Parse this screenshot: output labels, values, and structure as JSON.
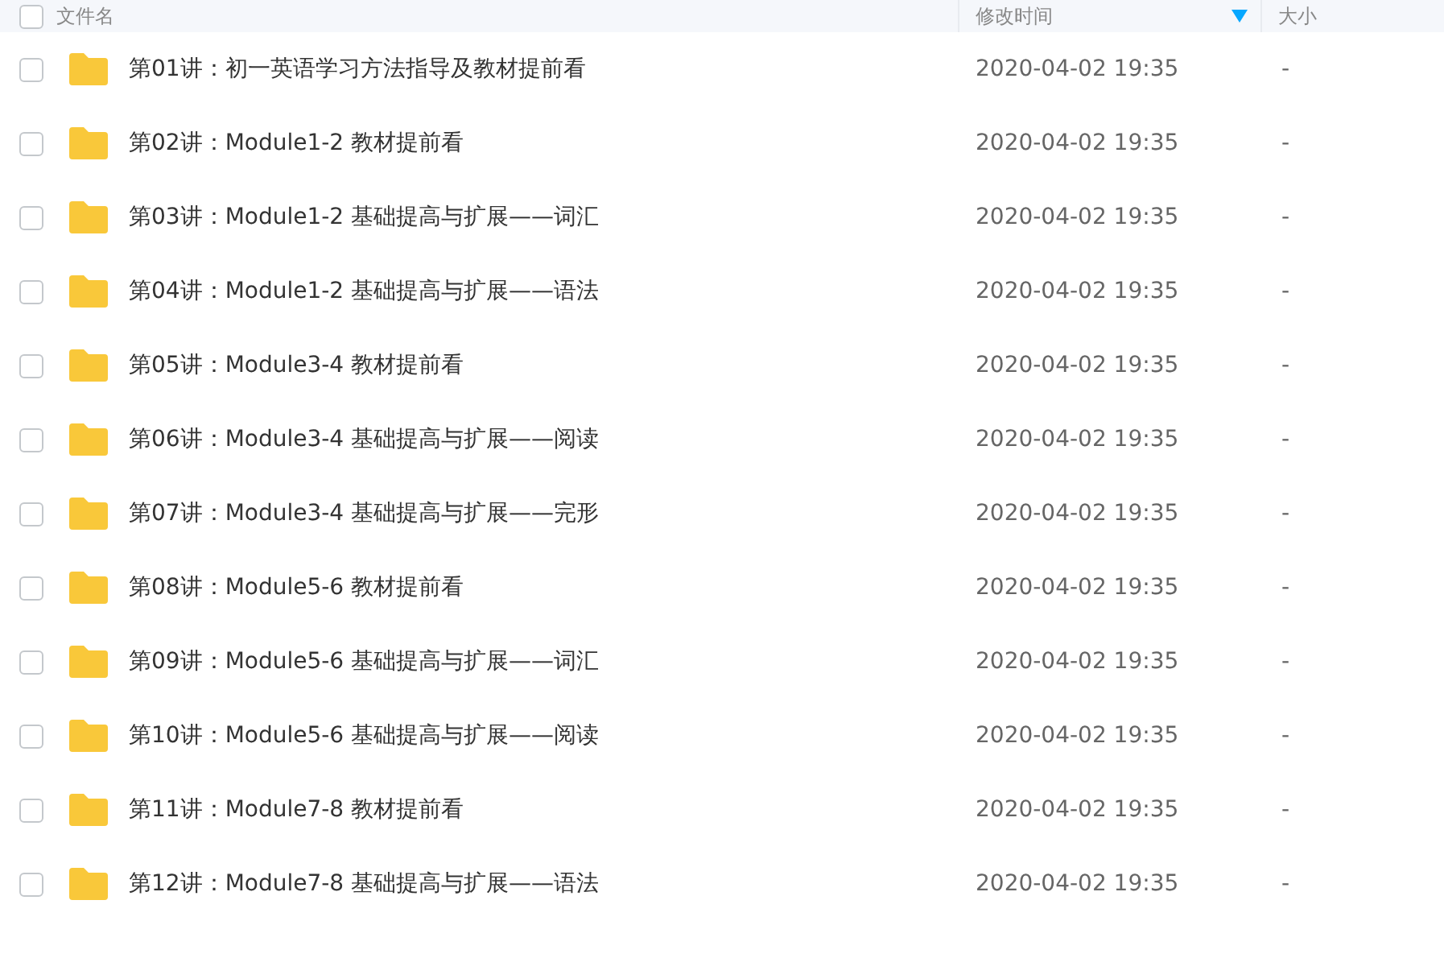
{
  "table": {
    "select_all_checked": false,
    "columns": [
      {
        "label": "文件名"
      },
      {
        "label": "修改时间",
        "sorted": true
      },
      {
        "label": "大小"
      }
    ],
    "rows": [
      {
        "name": "第01讲：初一英语学习方法指导及教材提前看",
        "modified": "2020-04-02 19:35",
        "size": "-",
        "checked": false
      },
      {
        "name": "第02讲：Module1-2 教材提前看",
        "modified": "2020-04-02 19:35",
        "size": "-",
        "checked": false
      },
      {
        "name": "第03讲：Module1-2 基础提高与扩展——词汇",
        "modified": "2020-04-02 19:35",
        "size": "-",
        "checked": false
      },
      {
        "name": "第04讲：Module1-2 基础提高与扩展——语法",
        "modified": "2020-04-02 19:35",
        "size": "-",
        "checked": false
      },
      {
        "name": "第05讲：Module3-4 教材提前看",
        "modified": "2020-04-02 19:35",
        "size": "-",
        "checked": false
      },
      {
        "name": "第06讲：Module3-4 基础提高与扩展——阅读",
        "modified": "2020-04-02 19:35",
        "size": "-",
        "checked": false
      },
      {
        "name": "第07讲：Module3-4 基础提高与扩展——完形",
        "modified": "2020-04-02 19:35",
        "size": "-",
        "checked": false
      },
      {
        "name": "第08讲：Module5-6 教材提前看",
        "modified": "2020-04-02 19:35",
        "size": "-",
        "checked": false
      },
      {
        "name": "第09讲：Module5-6 基础提高与扩展——词汇",
        "modified": "2020-04-02 19:35",
        "size": "-",
        "checked": false
      },
      {
        "name": "第10讲：Module5-6 基础提高与扩展——阅读",
        "modified": "2020-04-02 19:35",
        "size": "-",
        "checked": false
      },
      {
        "name": "第11讲：Module7-8 教材提前看",
        "modified": "2020-04-02 19:35",
        "size": "-",
        "checked": false
      },
      {
        "name": "第12讲：Module7-8 基础提高与扩展——语法",
        "modified": "2020-04-02 19:35",
        "size": "-",
        "checked": false
      }
    ]
  }
}
